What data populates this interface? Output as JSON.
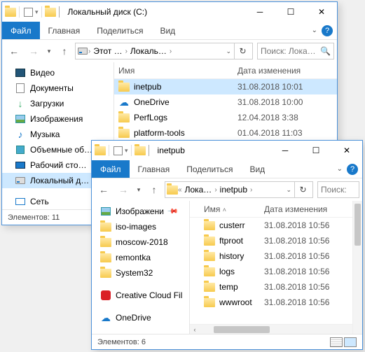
{
  "win1": {
    "title": "Локальный диск (C:)",
    "tabs": {
      "file": "Файл",
      "home": "Главная",
      "share": "Поделиться",
      "view": "Вид"
    },
    "crumbs": [
      "Этот …",
      "Локаль…"
    ],
    "search_ph": "Поиск: Лока…",
    "cols": {
      "name": "Имя",
      "date": "Дата изменения"
    },
    "tree": [
      {
        "icon": "video",
        "label": "Видео"
      },
      {
        "icon": "doc",
        "label": "Документы"
      },
      {
        "icon": "download",
        "label": "Загрузки"
      },
      {
        "icon": "picture",
        "label": "Изображения"
      },
      {
        "icon": "music",
        "label": "Музыка"
      },
      {
        "icon": "box",
        "label": "Объемные об…"
      },
      {
        "icon": "desktop",
        "label": "Рабочий сто…"
      },
      {
        "icon": "disk",
        "label": "Локальный д…",
        "selected": true
      },
      {
        "icon": "network",
        "label": "Сеть"
      }
    ],
    "items": [
      {
        "name": "inetpub",
        "date": "31.08.2018 10:01",
        "icon": "folder",
        "selected": true
      },
      {
        "name": "OneDrive",
        "date": "31.08.2018 10:00",
        "icon": "cloud"
      },
      {
        "name": "PerfLogs",
        "date": "12.04.2018 3:38",
        "icon": "folder"
      },
      {
        "name": "platform-tools",
        "date": "01.04.2018 11:03",
        "icon": "folder"
      }
    ],
    "status": "Элементов: 11"
  },
  "win2": {
    "title": "inetpub",
    "tabs": {
      "file": "Файл",
      "home": "Главная",
      "share": "Поделиться",
      "view": "Вид"
    },
    "crumbs": [
      "Лока…",
      "inetpub"
    ],
    "search_ph": "Поиск:",
    "cols": {
      "name": "Имя",
      "date": "Дата изменения"
    },
    "tree": [
      {
        "icon": "picture",
        "label": "Изображени",
        "pinned": true
      },
      {
        "icon": "folder",
        "label": "iso-images"
      },
      {
        "icon": "folder",
        "label": "moscow-2018"
      },
      {
        "icon": "folder",
        "label": "remontka"
      },
      {
        "icon": "folder",
        "label": "System32"
      },
      {
        "icon": "cc",
        "label": "Creative Cloud Fil"
      },
      {
        "icon": "cloud",
        "label": "OneDrive"
      }
    ],
    "items": [
      {
        "name": "custerr",
        "date": "31.08.2018 10:56",
        "icon": "folder"
      },
      {
        "name": "ftproot",
        "date": "31.08.2018 10:56",
        "icon": "folder"
      },
      {
        "name": "history",
        "date": "31.08.2018 10:56",
        "icon": "folder"
      },
      {
        "name": "logs",
        "date": "31.08.2018 10:56",
        "icon": "folder"
      },
      {
        "name": "temp",
        "date": "31.08.2018 10:56",
        "icon": "folder"
      },
      {
        "name": "wwwroot",
        "date": "31.08.2018 10:56",
        "icon": "folder"
      }
    ],
    "status": "Элементов: 6"
  }
}
